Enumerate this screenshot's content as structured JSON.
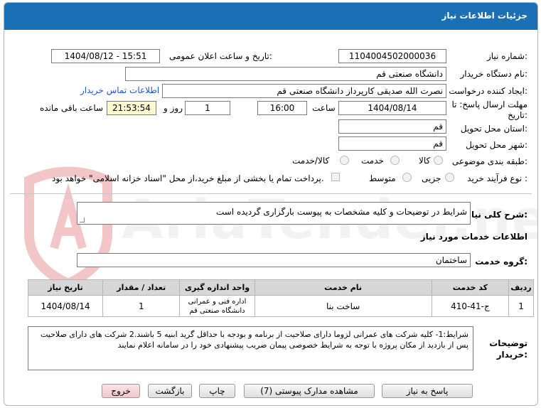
{
  "page": {
    "title": "جزئیات اطلاعات نیاز"
  },
  "form": {
    "need_number": {
      "label": "شماره نیاز:",
      "value": "1104004502000036"
    },
    "announce_datetime": {
      "label": "تاریخ و ساعت اعلان عمومی:",
      "value": "1404/08/12 - 15:51"
    },
    "buyer_org": {
      "label": "نام دستگاه خریدار:",
      "value": "دانشگاه صنعتی قم"
    },
    "requester": {
      "label": "ایجاد کننده درخواست:",
      "value": "نصرت الله صدیقی کارپرداز دانشگاه صنعتی قم",
      "contact_link": "اطلاعات تماس خریدار"
    },
    "deadline": {
      "label_line1": "مهلت ارسال پاسخ: تا",
      "label_line2": "تاریخ:",
      "date": "1404/08/14",
      "time_label": "ساعت",
      "time": "16:00",
      "days": "1",
      "days_label": "روز و",
      "remaining": "21:53:54",
      "remaining_label": "ساعت باقی مانده"
    },
    "delivery_province": {
      "label": "استان محل تحویل:",
      "value": "قم"
    },
    "delivery_city": {
      "label": "شهر محل تحویل:",
      "value": "قم"
    },
    "category": {
      "label": "طبقه بندی موضوعی:",
      "options": [
        "کالا",
        "خدمت",
        "کالا/خدمت"
      ]
    },
    "purchase_type": {
      "label": "نوع فرآیند خرید :",
      "options": [
        "جزیی",
        "متوسط"
      ],
      "payment_note": "پرداخت تمام یا بخشی از مبلغ خرید،از محل \"اسناد خزانه اسلامی\" خواهد بود."
    }
  },
  "general_description": {
    "label": "شرح کلی نیاز:",
    "value": "شرایط در توضیحات و کلیه مشخصات به پیوست بارگزاری گردیده است"
  },
  "services_section": {
    "title": "اطلاعات خدمات مورد نیاز",
    "group_label": "گروه خدمت:",
    "group_value": "ساختمان"
  },
  "table": {
    "headers": [
      "ردیف",
      "کد خدمت",
      "نام خدمت",
      "واحد اندازه گیری",
      "تعداد / مقدار",
      "تاریخ نیاز"
    ],
    "rows": [
      {
        "row": "1",
        "code": "ج-41-410",
        "name": "ساخت بنا",
        "unit": "اداره فنی و عمرانی دانشگاه صنعتی قم",
        "qty": "1",
        "date": "1404/08/14"
      }
    ]
  },
  "buyer_notes": {
    "label_line1": "توضیحات",
    "label_line2": "خریدار:",
    "value": "شرایط:1- کلیه شرکت های عمرانی لزوما دارای صلاحیت از برنامه و بودجه با حداقل گرید ابنیه 5 باشند.2 شرکت های دارای صلاحیت پس از بازدید از مکان پروژه با توجه به شرایط خصوصی پیمان ضریب پیشنهادی خود را در سامانه اعلام نمایند"
  },
  "buttons": {
    "reply": "پاسخ به نیاز",
    "view_docs": "مشاهده مدارک پیوستی (7)",
    "print": "چاپ",
    "back": "بازگشت",
    "exit": "خروج"
  },
  "watermark": {
    "text": "AriaTender.neT"
  },
  "colors": {
    "titlebar": "#1a6fb5",
    "link": "#1e56c8",
    "remaining_bg": "#fffbd0",
    "exit_bg": "#f0c9c9"
  }
}
